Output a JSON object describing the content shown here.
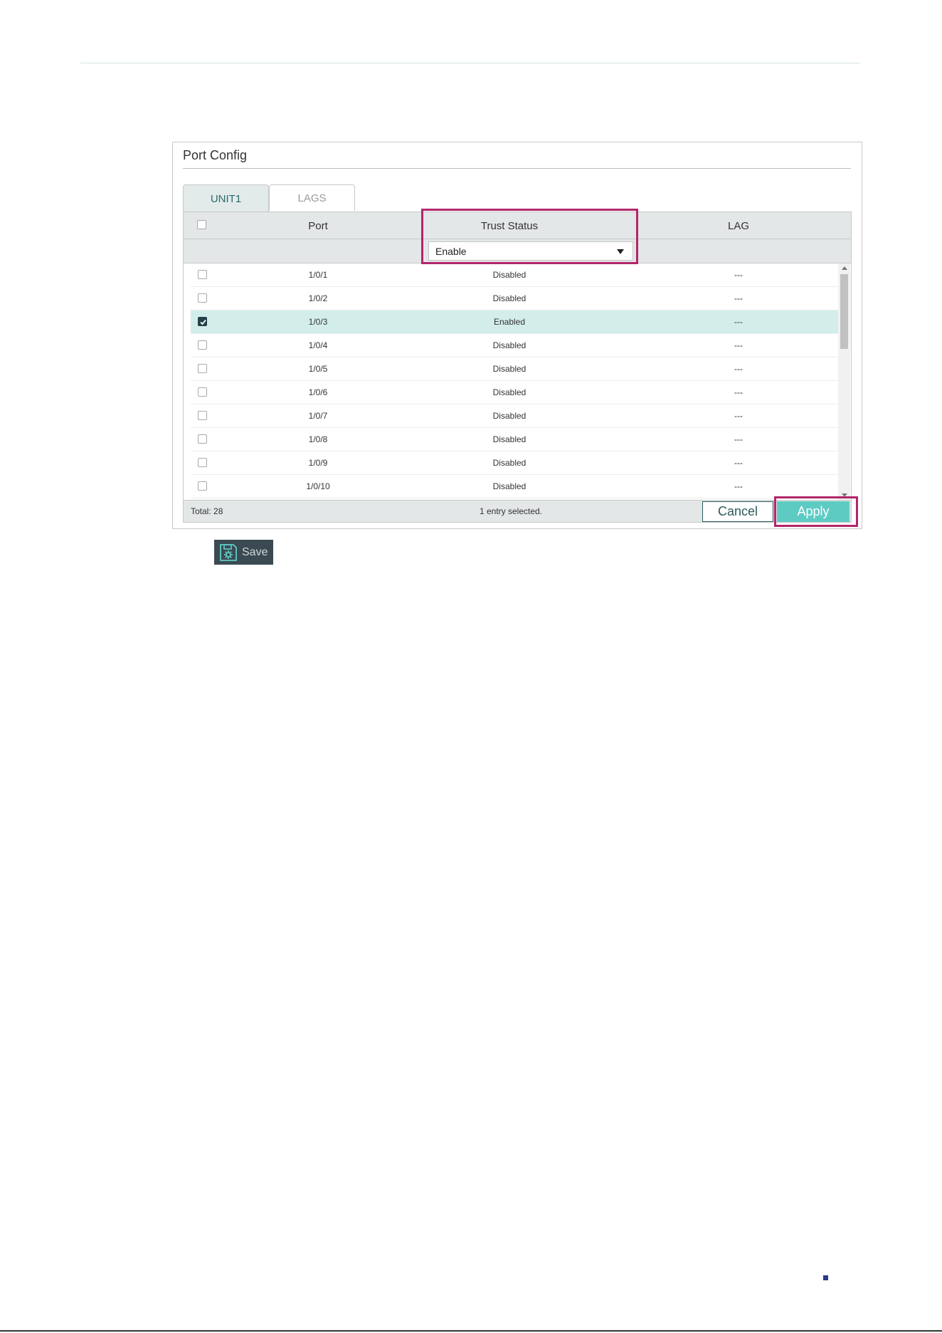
{
  "panel": {
    "title": "Port Config"
  },
  "tabs": [
    {
      "label": "UNIT1",
      "active": true
    },
    {
      "label": "LAGS",
      "active": false
    }
  ],
  "table": {
    "columns": {
      "port": "Port",
      "trust_status": "Trust Status",
      "lag": "LAG"
    },
    "filter": {
      "trust_status_value": "Enable"
    },
    "rows": [
      {
        "port": "1/0/1",
        "trust_status": "Disabled",
        "lag": "---",
        "checked": false
      },
      {
        "port": "1/0/2",
        "trust_status": "Disabled",
        "lag": "---",
        "checked": false
      },
      {
        "port": "1/0/3",
        "trust_status": "Enabled",
        "lag": "---",
        "checked": true
      },
      {
        "port": "1/0/4",
        "trust_status": "Disabled",
        "lag": "---",
        "checked": false
      },
      {
        "port": "1/0/5",
        "trust_status": "Disabled",
        "lag": "---",
        "checked": false
      },
      {
        "port": "1/0/6",
        "trust_status": "Disabled",
        "lag": "---",
        "checked": false
      },
      {
        "port": "1/0/7",
        "trust_status": "Disabled",
        "lag": "---",
        "checked": false
      },
      {
        "port": "1/0/8",
        "trust_status": "Disabled",
        "lag": "---",
        "checked": false
      },
      {
        "port": "1/0/9",
        "trust_status": "Disabled",
        "lag": "---",
        "checked": false
      },
      {
        "port": "1/0/10",
        "trust_status": "Disabled",
        "lag": "---",
        "checked": false
      }
    ]
  },
  "footer": {
    "total": "Total: 28",
    "selected_count": "1 entry selected.",
    "cancel_label": "Cancel",
    "apply_label": "Apply"
  },
  "save_button": {
    "label": "Save",
    "icon": "save-gear-icon"
  },
  "colors": {
    "accent": "#5ecbc3",
    "highlight": "#b2266c",
    "selected_row": "#d3eeea",
    "header_bg": "#e3e7e7",
    "save_bg": "#3b4a52"
  }
}
